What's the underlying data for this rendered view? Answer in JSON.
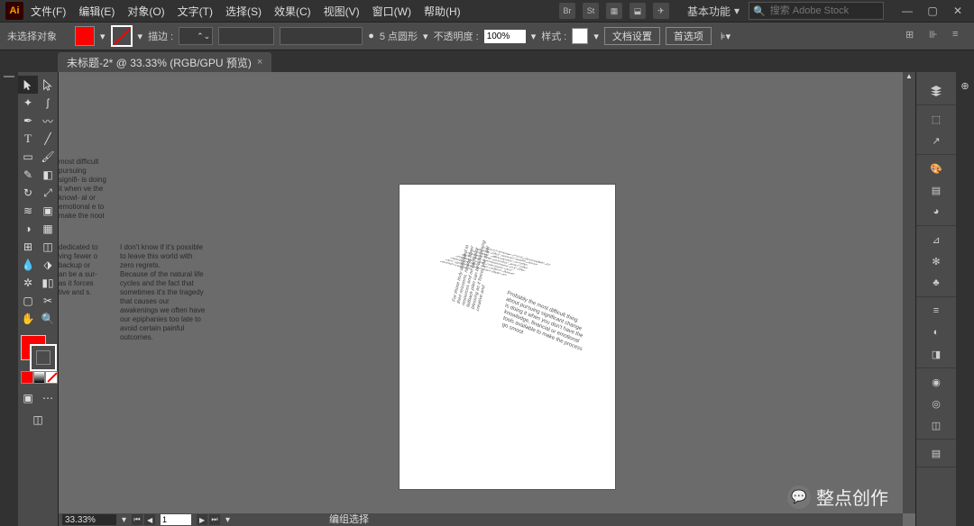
{
  "menu": {
    "file": "文件(F)",
    "edit": "编辑(E)",
    "object": "对象(O)",
    "text": "文字(T)",
    "select": "选择(S)",
    "effect": "效果(C)",
    "view": "视图(V)",
    "window": "窗口(W)",
    "help": "帮助(H)"
  },
  "title_icons": {
    "br": "Br",
    "st": "St"
  },
  "workspace": "基本功能",
  "search_placeholder": "搜索 Adobe Stock",
  "ctrl": {
    "nosel": "未选择对象",
    "stroke": "描边 :",
    "shape": "5 点圆形",
    "opacity": "不透明度 :",
    "opacity_val": "100%",
    "style": "样式 :",
    "docset": "文档设置",
    "prefs": "首选项"
  },
  "tab": "未标题-2* @ 33.33% (RGB/GPU 预览)",
  "colors": {
    "fill": "#ff0000"
  },
  "text3d": {
    "top": "I don't know if it's possible to leave this world with zero regrets. Because of the natural life cycles and the fact that sometimes it's the tragedy that causes our awakenings we often have our epiphanies too late to avoid certain",
    "left": "For those truly dedicated to their missions, having fewer resources and no backup or fallback plan can be a surprising blessing as it forces you to get creative and",
    "right": "Probably the most difficult thing about pursuing significant change is doing it when you don't have the knowledge, financial or emotional tools available to make the process go smoot"
  },
  "side_text": {
    "s1": "most difficult pursuing signifi- is doing it when ve the knowl- al or emotional e to make the noot",
    "s2": "dedicated to ving fewer o backup or an be a sur- as it forces tive and s.",
    "s3": "I don't know if it's possible to leave this world with zero regrets.\n  Because of the natural life cycles and the fact that sometimes it's the tragedy that causes our awakenings we often have our epiphanies too late to avoid certain painful outcomes."
  },
  "bottom": {
    "zoom": "33.33%",
    "page": "1",
    "status": "编组选择"
  },
  "watermark": "整点创作"
}
